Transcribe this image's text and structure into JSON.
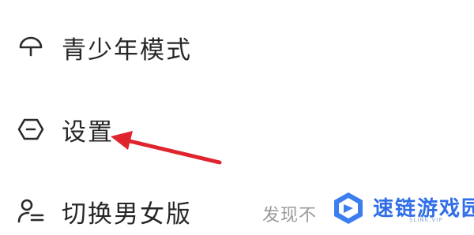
{
  "menu": {
    "items": [
      {
        "label": "青少年模式",
        "icon": "umbrella-icon"
      },
      {
        "label": "设置",
        "icon": "settings-hexagon-icon"
      },
      {
        "label": "切换男女版",
        "icon": "switch-gender-icon",
        "hint": "发现不"
      }
    ]
  },
  "annotation": {
    "color": "#e0242e",
    "points_to": "settings"
  },
  "watermark": {
    "brand": "速链游戏园",
    "domain": "SLINK.VIP",
    "color": "#2f6ee8"
  }
}
